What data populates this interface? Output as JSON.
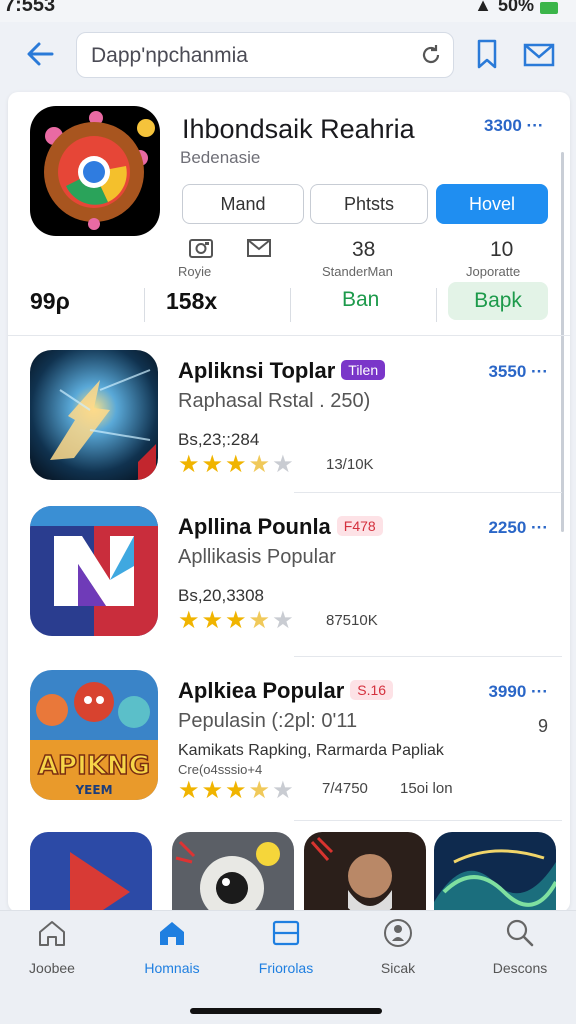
{
  "status": {
    "time": "7:553",
    "battery": "50%"
  },
  "header": {
    "search_value": "Dapp'npchanmia"
  },
  "featured": {
    "title": "Ihbondsaik Reahria",
    "subtitle": "Bedenasie",
    "price": "3300 ···",
    "buttons": {
      "mand": "Mand",
      "phtsts": "Phtsts",
      "hovel": "Hovel"
    },
    "meta": [
      {
        "num": "",
        "label": "Royie"
      },
      {
        "num": "",
        "label": ""
      },
      {
        "num": "38",
        "label": "StanderMan"
      },
      {
        "num": "10",
        "label": "Joporatte"
      }
    ],
    "stats": {
      "a": "99ρ",
      "b": "158x",
      "c": "Ban",
      "d": "Bapk"
    }
  },
  "apps": [
    {
      "title": "Apliknsi Toplar",
      "badge": "Tilen",
      "subtitle": "Raphasal Rstal . 250)",
      "size": "Bs,23;:284",
      "reviews": "13/10K",
      "price": "3550 ···",
      "stars": 4
    },
    {
      "title": "Apllina Pounla",
      "badge": "F478",
      "subtitle": "Apllikasis Popular",
      "size": "Bs,20,3308",
      "reviews": "87510K",
      "price": "2250 ···",
      "stars": 3.5
    },
    {
      "title": "Aplkiea Popular",
      "badge": "S.16",
      "subtitle": "Pepulasin (:2pl: 0'11",
      "size": "Kamikats Rapking, Rarmarda Papliak",
      "extra": "Cre(o4sssio+4",
      "reviews": "7/4750",
      "reviews2": "15oi lon",
      "price": "3990 ···",
      "stars": 3.5
    }
  ],
  "tabs": [
    {
      "label": "Joobee",
      "icon": "home-outline-icon"
    },
    {
      "label": "Homnais",
      "icon": "home-filled-icon"
    },
    {
      "label": "Friorolas",
      "icon": "window-icon"
    },
    {
      "label": "Sicak",
      "icon": "person-circle-icon"
    },
    {
      "label": "Descons",
      "icon": "search-icon"
    }
  ],
  "colors": {
    "accent": "#1f8ef1",
    "link": "#2a66c7",
    "star": "#f0b400",
    "green": "#1d9a4b"
  }
}
